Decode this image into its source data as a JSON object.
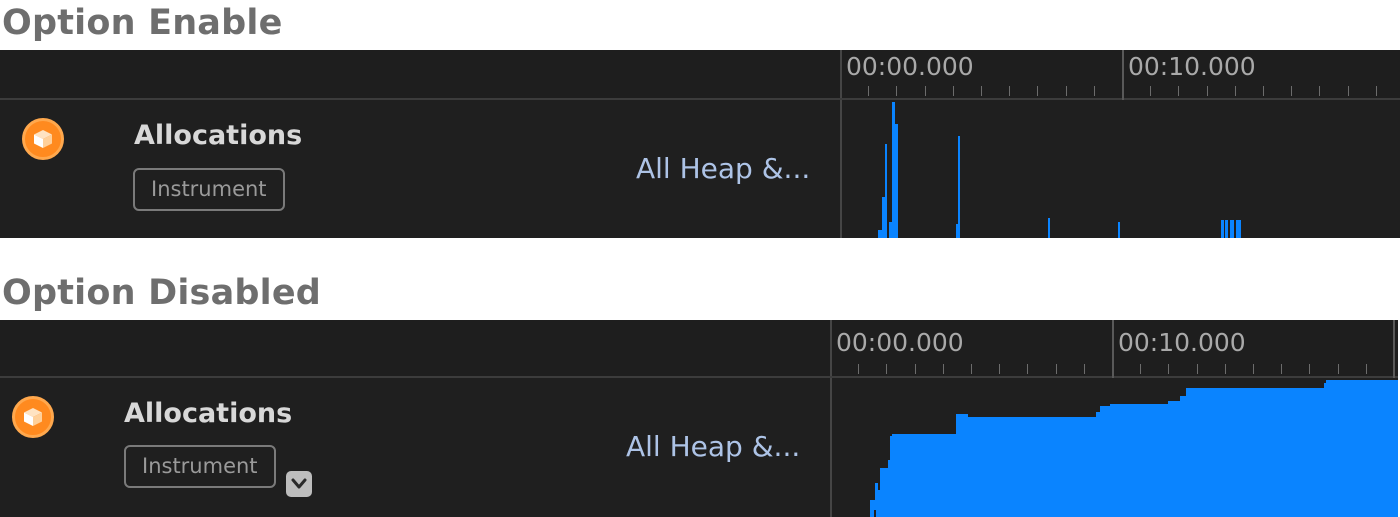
{
  "sections": [
    {
      "heading": "Option Enable",
      "timeline": {
        "labels": [
          "00:00.000",
          "00:10.000"
        ]
      },
      "track": {
        "title": "Allocations",
        "badge": "Instrument",
        "mode": "All Heap &...",
        "icon": "allocations-cube-icon",
        "has_dropdown": false
      }
    },
    {
      "heading": "Option Disabled",
      "timeline": {
        "labels": [
          "00:00.000",
          "00:10.000"
        ]
      },
      "track": {
        "title": "Allocations",
        "badge": "Instrument",
        "mode": "All Heap &...",
        "icon": "allocations-cube-icon",
        "has_dropdown": true,
        "dropdown_icon": "chevron-down-icon"
      }
    }
  ],
  "colors": {
    "panel_bg": "#1f1f1f",
    "graph_fill": "#0a84ff",
    "icon_orange": "#ff8a1f",
    "mode_text": "#adc3e6",
    "heading_text": "#6e6e6e"
  }
}
